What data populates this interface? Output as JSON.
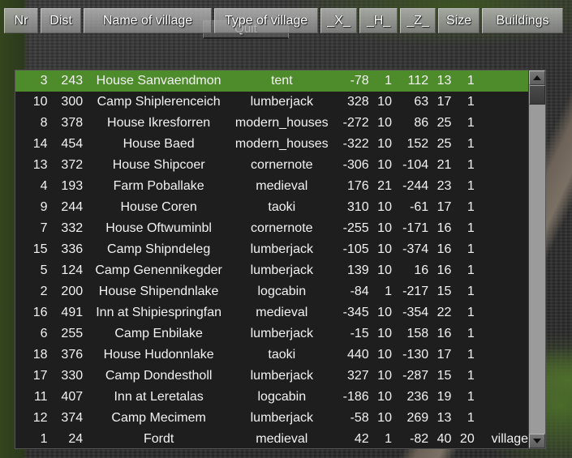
{
  "header": {
    "columns": [
      {
        "label": "Nr",
        "key": "nr"
      },
      {
        "label": "Dist",
        "key": "dist"
      },
      {
        "label": "Name of village",
        "key": "name"
      },
      {
        "label": "Type of village",
        "key": "type"
      },
      {
        "label": "_X_",
        "key": "x"
      },
      {
        "label": "_H_",
        "key": "h"
      },
      {
        "label": "_Z_",
        "key": "z"
      },
      {
        "label": "Size",
        "key": "size"
      },
      {
        "label": "Buildings",
        "key": "buildings"
      }
    ]
  },
  "quit_button": {
    "label": "Quit"
  },
  "colors": {
    "selected_row": "#4e8b2b",
    "panel_background": "#1e1e1e",
    "text": "#f2f2f2",
    "scrollbar_track": "#9b9b9b"
  },
  "scrollbar": {
    "up_arrow": "triangle-up-icon",
    "down_arrow": "triangle-down-icon"
  },
  "table": {
    "rows": [
      {
        "nr": "3",
        "dist": "243",
        "name": "House Sanvaendmon",
        "type": "tent",
        "x": "-78",
        "h": "1",
        "z": "112",
        "size": "13",
        "buildings": "1",
        "extra": "",
        "selected": true
      },
      {
        "nr": "10",
        "dist": "300",
        "name": "Camp Shiplerenceich",
        "type": "lumberjack",
        "x": "328",
        "h": "10",
        "z": "63",
        "size": "17",
        "buildings": "1",
        "extra": "",
        "selected": false
      },
      {
        "nr": "8",
        "dist": "378",
        "name": "House Ikresforren",
        "type": "modern_houses",
        "x": "-272",
        "h": "10",
        "z": "86",
        "size": "25",
        "buildings": "1",
        "extra": "",
        "selected": false
      },
      {
        "nr": "14",
        "dist": "454",
        "name": "House Baed",
        "type": "modern_houses",
        "x": "-322",
        "h": "10",
        "z": "152",
        "size": "25",
        "buildings": "1",
        "extra": "",
        "selected": false
      },
      {
        "nr": "13",
        "dist": "372",
        "name": "House Shipcoer",
        "type": "cornernote",
        "x": "-306",
        "h": "10",
        "z": "-104",
        "size": "21",
        "buildings": "1",
        "extra": "",
        "selected": false
      },
      {
        "nr": "4",
        "dist": "193",
        "name": "Farm Poballake",
        "type": "medieval",
        "x": "176",
        "h": "21",
        "z": "-244",
        "size": "23",
        "buildings": "1",
        "extra": "",
        "selected": false
      },
      {
        "nr": "9",
        "dist": "244",
        "name": "House Coren",
        "type": "taoki",
        "x": "310",
        "h": "10",
        "z": "-61",
        "size": "17",
        "buildings": "1",
        "extra": "",
        "selected": false
      },
      {
        "nr": "7",
        "dist": "332",
        "name": "House Oftwuminbl",
        "type": "cornernote",
        "x": "-255",
        "h": "10",
        "z": "-171",
        "size": "16",
        "buildings": "1",
        "extra": "",
        "selected": false
      },
      {
        "nr": "15",
        "dist": "336",
        "name": "Camp Shipndeleg",
        "type": "lumberjack",
        "x": "-105",
        "h": "10",
        "z": "-374",
        "size": "16",
        "buildings": "1",
        "extra": "",
        "selected": false
      },
      {
        "nr": "5",
        "dist": "124",
        "name": "Camp Genennikegder",
        "type": "lumberjack",
        "x": "139",
        "h": "10",
        "z": "16",
        "size": "16",
        "buildings": "1",
        "extra": "",
        "selected": false
      },
      {
        "nr": "2",
        "dist": "200",
        "name": "House Shipendnlake",
        "type": "logcabin",
        "x": "-84",
        "h": "1",
        "z": "-217",
        "size": "15",
        "buildings": "1",
        "extra": "",
        "selected": false
      },
      {
        "nr": "16",
        "dist": "491",
        "name": "Inn at Shipiespringfan",
        "type": "medieval",
        "x": "-345",
        "h": "10",
        "z": "-354",
        "size": "22",
        "buildings": "1",
        "extra": "",
        "selected": false
      },
      {
        "nr": "6",
        "dist": "255",
        "name": "Camp Enbilake",
        "type": "lumberjack",
        "x": "-15",
        "h": "10",
        "z": "158",
        "size": "16",
        "buildings": "1",
        "extra": "",
        "selected": false
      },
      {
        "nr": "18",
        "dist": "376",
        "name": "House Hudonnlake",
        "type": "taoki",
        "x": "440",
        "h": "10",
        "z": "-130",
        "size": "17",
        "buildings": "1",
        "extra": "",
        "selected": false
      },
      {
        "nr": "17",
        "dist": "330",
        "name": "Camp Dondestholl",
        "type": "lumberjack",
        "x": "327",
        "h": "10",
        "z": "-287",
        "size": "15",
        "buildings": "1",
        "extra": "",
        "selected": false
      },
      {
        "nr": "11",
        "dist": "407",
        "name": "Inn at Leretalas",
        "type": "logcabin",
        "x": "-186",
        "h": "10",
        "z": "236",
        "size": "19",
        "buildings": "1",
        "extra": "",
        "selected": false
      },
      {
        "nr": "12",
        "dist": "374",
        "name": "Camp Mecimem",
        "type": "lumberjack",
        "x": "-58",
        "h": "10",
        "z": "269",
        "size": "13",
        "buildings": "1",
        "extra": "",
        "selected": false
      },
      {
        "nr": "1",
        "dist": "24",
        "name": "Fordt",
        "type": "medieval",
        "x": "42",
        "h": "1",
        "z": "-82",
        "size": "40",
        "buildings": "20",
        "extra": "village",
        "selected": false
      }
    ]
  }
}
